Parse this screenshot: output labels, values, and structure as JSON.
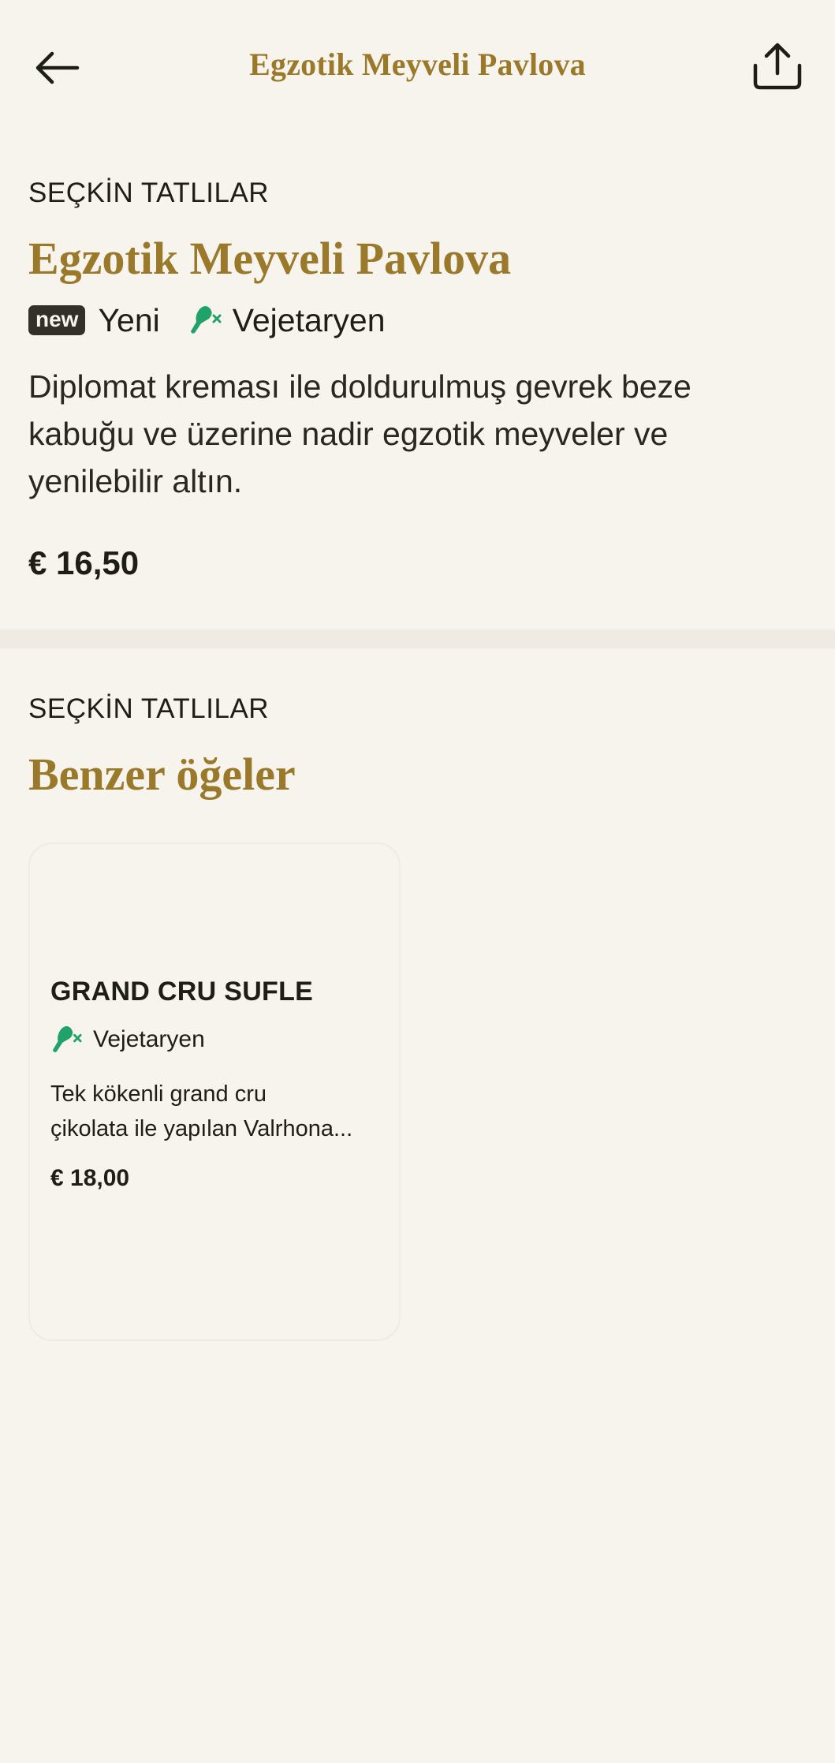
{
  "header": {
    "title": "Egzotik Meyveli Pavlova",
    "back_icon": "arrow-left-icon",
    "share_icon": "share-icon"
  },
  "product": {
    "category": "SEÇKİN TATLILAR",
    "title": "Egzotik Meyveli Pavlova",
    "new_tag": "new",
    "new_label": "Yeni",
    "veg_label": "Vejetaryen",
    "description": "Diplomat kreması ile doldurulmuş gevrek beze kabuğu ve üzerine nadir egzotik meyveler ve yenilebilir altın.",
    "price": "€ 16,50"
  },
  "similar": {
    "category": "SEÇKİN TATLILAR",
    "title": "Benzer öğeler",
    "items": [
      {
        "name": "GRAND CRU SUFLE",
        "veg_label": "Vejetaryen",
        "description_line1": "Tek kökenli grand cru",
        "description_line2": "çikolata ile yapılan Valrhona...",
        "price": "€ 18,00"
      }
    ]
  },
  "colors": {
    "background": "#f7f4ee",
    "accent_gold": "#9a7a2a",
    "text_dark": "#1f1d17",
    "veg_green": "#1fa36a",
    "divider": "#efebe2"
  }
}
